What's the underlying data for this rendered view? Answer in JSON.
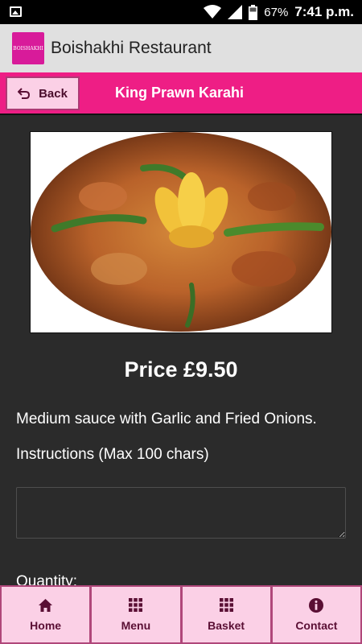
{
  "status_bar": {
    "battery": "67%",
    "time": "7:41 p.m."
  },
  "app_bar": {
    "logo_text": "BOISHAKHI",
    "title": "Boishakhi Restaurant"
  },
  "header": {
    "back_label": "Back",
    "title": "King Prawn Karahi"
  },
  "item": {
    "price": "Price £9.50",
    "description": "Medium sauce with Garlic and Fried Onions.",
    "instructions_label": "Instructions (Max 100 chars)",
    "instructions_value": "",
    "quantity_label": "Quantity:"
  },
  "bottom_nav": {
    "home": "Home",
    "menu": "Menu",
    "basket": "Basket",
    "contact": "Contact"
  },
  "colors": {
    "accent": "#ee1e85",
    "button_bg": "#fbd0e6",
    "page_bg": "#2b2b2b"
  }
}
